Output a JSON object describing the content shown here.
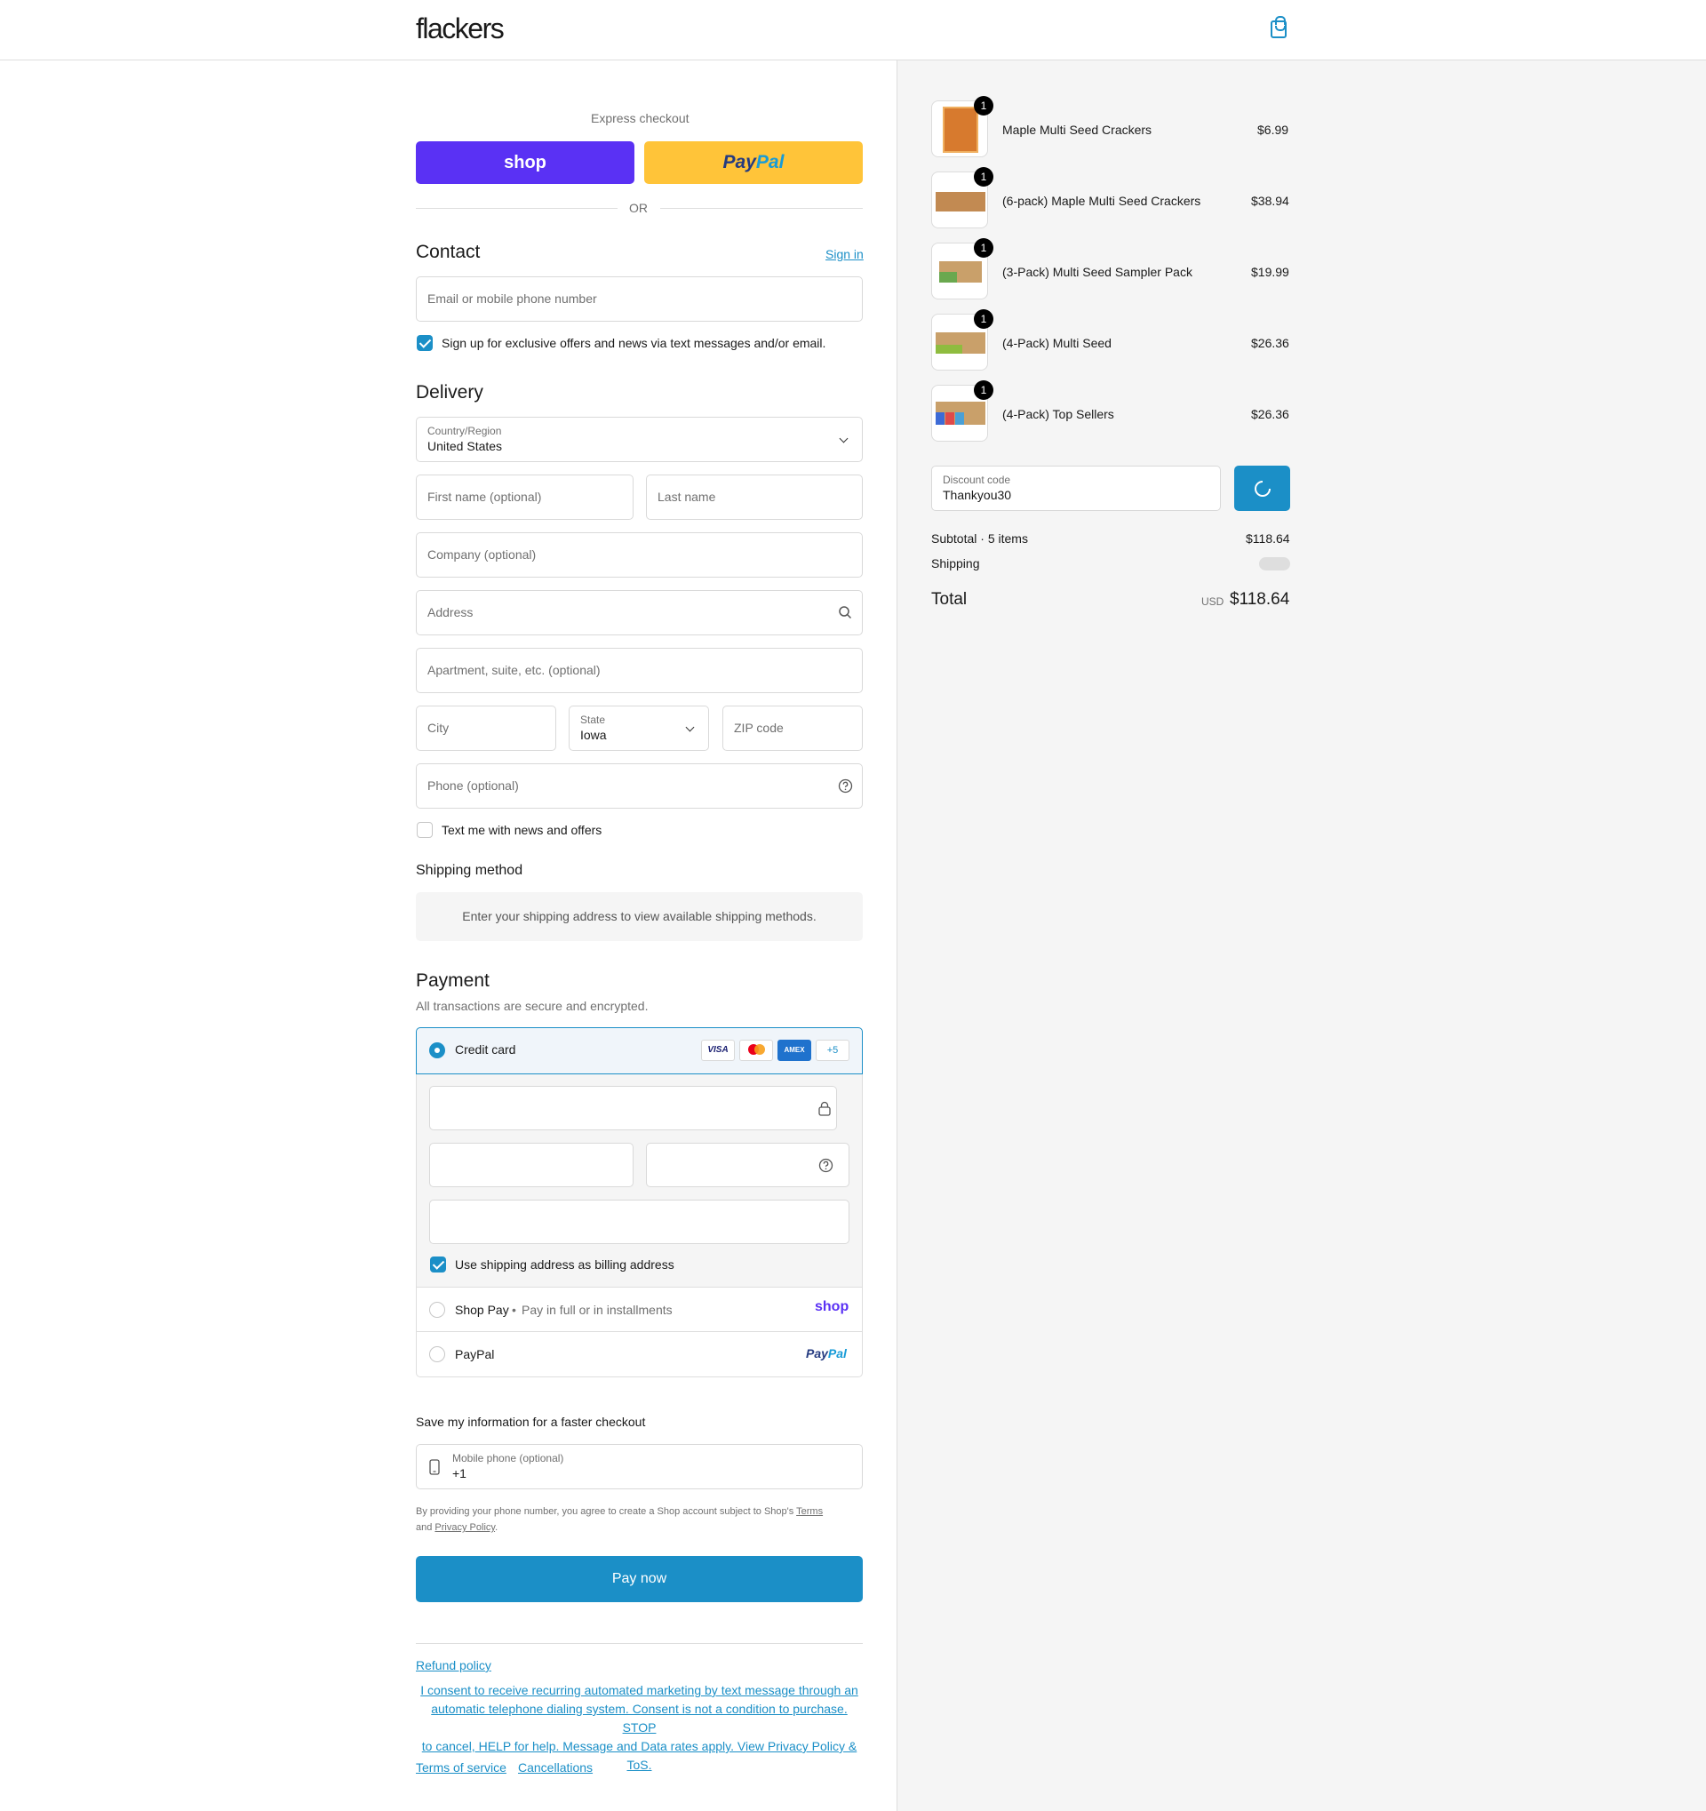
{
  "header": {
    "logo": "flackers",
    "cart_icon": "shopping-bag-icon"
  },
  "express": {
    "title": "Express checkout",
    "shop_label": "shop",
    "paypal_pay": "Pay",
    "paypal_pal": "Pal",
    "or": "OR"
  },
  "contact": {
    "title": "Contact",
    "sign_in": "Sign in",
    "email_placeholder": "Email or mobile phone number",
    "signup_label": "Sign up for exclusive offers and news via text messages and/or email.",
    "signup_checked": true
  },
  "delivery": {
    "title": "Delivery",
    "country_label": "Country/Region",
    "country_value": "United States",
    "first_name_placeholder": "First name (optional)",
    "last_name_placeholder": "Last name",
    "company_placeholder": "Company (optional)",
    "address_placeholder": "Address",
    "apartment_placeholder": "Apartment, suite, etc. (optional)",
    "city_placeholder": "City",
    "state_label": "State",
    "state_value": "Iowa",
    "zip_placeholder": "ZIP code",
    "phone_placeholder": "Phone (optional)",
    "text_me_label": "Text me with news and offers",
    "text_me_checked": false
  },
  "shipping": {
    "title": "Shipping method",
    "notice": "Enter your shipping address to view available shipping methods."
  },
  "payment": {
    "title": "Payment",
    "subtitle": "All transactions are secure and encrypted.",
    "credit_card_label": "Credit card",
    "card_brands": [
      "VISA",
      "",
      "AMEX",
      "+5"
    ],
    "billing_label": "Use shipping address as billing address",
    "billing_checked": true,
    "shop_pay_label": "Shop Pay",
    "shop_pay_sub": "Pay in full or in installments",
    "shop_pay_logo": "shop",
    "paypal_label": "PayPal",
    "paypal_logo_pay": "Pay",
    "paypal_logo_pal": "Pal"
  },
  "save_info": {
    "title": "Save my information for a faster checkout",
    "mobile_label": "Mobile phone (optional)",
    "mobile_value": "+1",
    "disclaimer_1": "By providing your phone number, you agree to create a Shop account subject to Shop's ",
    "terms": "Terms",
    "and": "and ",
    "privacy": "Privacy Policy",
    "period": "."
  },
  "pay_now": "Pay now",
  "footer": {
    "refund": "Refund policy",
    "consent": [
      "I consent to receive recurring automated marketing by text message through an",
      "automatic telephone dialing system. Consent is not a condition to purchase. STOP",
      "to cancel, HELP for help. Message and Data rates apply. View Privacy Policy &",
      "ToS."
    ],
    "terms": "Terms of service",
    "cancellations": "Cancellations"
  },
  "order": {
    "items": [
      {
        "name": "Maple Multi Seed Crackers",
        "price": "$6.99",
        "qty": "1"
      },
      {
        "name": "(6-pack) Maple Multi Seed Crackers",
        "price": "$38.94",
        "qty": "1"
      },
      {
        "name": "(3-Pack) Multi Seed Sampler Pack",
        "price": "$19.99",
        "qty": "1"
      },
      {
        "name": "(4-Pack) Multi Seed",
        "price": "$26.36",
        "qty": "1"
      },
      {
        "name": "(4-Pack) Top Sellers",
        "price": "$26.36",
        "qty": "1"
      }
    ],
    "discount_label": "Discount code",
    "discount_value": "Thankyou30",
    "subtotal_label": "Subtotal · 5 items",
    "subtotal_value": "$118.64",
    "shipping_label": "Shipping",
    "total_label": "Total",
    "currency": "USD",
    "total_value": "$118.64"
  },
  "colors": {
    "accent": "#1b8fc7",
    "shop": "#5a31f4",
    "paypal": "#ffc439"
  }
}
